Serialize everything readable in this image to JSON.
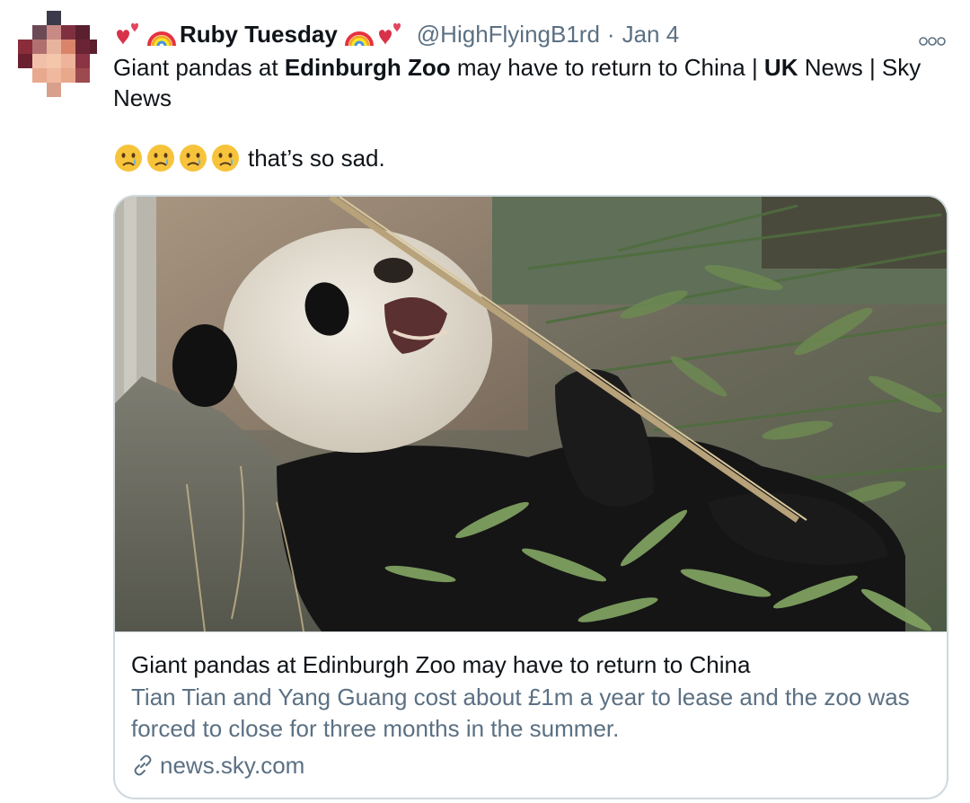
{
  "tweet": {
    "display_name": "Ruby Tuesday",
    "handle": "@HighFlyingB1rd",
    "separator": "·",
    "date": "Jan 4",
    "text_parts": {
      "p1": "Giant pandas at ",
      "p2": "Edinburgh Zoo",
      "p3": " may have to return to China | ",
      "p4": "UK",
      "p5": " News | Sky News"
    },
    "reaction_text": "that’s so sad.",
    "name_emojis": [
      "two-hearts-icon",
      "rainbow-icon"
    ],
    "reaction_emojis": [
      "crying-face-icon",
      "crying-face-icon",
      "crying-face-icon",
      "crying-face-icon"
    ]
  },
  "card": {
    "image_description_icon": "panda-eating-bamboo-photo",
    "title": "Giant pandas at Edinburgh Zoo may have to return to China",
    "description": "Tian Tian and Yang Guang cost about £1m a year to lease and the zoo was forced to close for three months in the summer.",
    "domain": "news.sky.com"
  },
  "colors": {
    "text_primary": "#0f1419",
    "text_secondary": "#5b7083",
    "border": "#cfd9de"
  }
}
